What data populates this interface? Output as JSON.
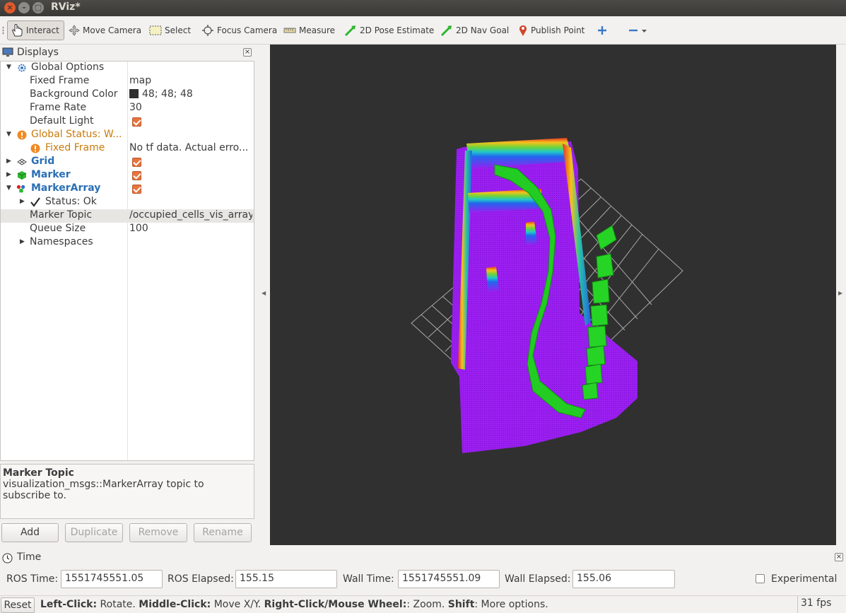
{
  "window": {
    "title": "RViz*"
  },
  "toolbar": {
    "tools": [
      {
        "label": "Interact",
        "icon": "hand-icon",
        "active": true
      },
      {
        "label": "Move Camera",
        "icon": "move-camera-icon"
      },
      {
        "label": "Select",
        "icon": "select-icon"
      },
      {
        "label": "Focus Camera",
        "icon": "focus-camera-icon"
      },
      {
        "label": "Measure",
        "icon": "ruler-icon"
      },
      {
        "label": "2D Pose Estimate",
        "icon": "pose-estimate-icon"
      },
      {
        "label": "2D Nav Goal",
        "icon": "nav-goal-icon"
      },
      {
        "label": "Publish Point",
        "icon": "map-pin-icon"
      }
    ]
  },
  "displays": {
    "title": "Displays",
    "rows": [
      {
        "name": "Global Options",
        "value": ""
      },
      {
        "name": "Fixed Frame",
        "value": "map"
      },
      {
        "name": "Background Color",
        "value": "48; 48; 48"
      },
      {
        "name": "Frame Rate",
        "value": "30"
      },
      {
        "name": "Default Light",
        "value": ""
      },
      {
        "name": "Global Status: W...",
        "value": ""
      },
      {
        "name": "Fixed Frame",
        "value": "No tf data.  Actual erro..."
      },
      {
        "name": "Grid",
        "value": ""
      },
      {
        "name": "Marker",
        "value": ""
      },
      {
        "name": "MarkerArray",
        "value": ""
      },
      {
        "name": "Status: Ok",
        "value": ""
      },
      {
        "name": "Marker Topic",
        "value": "/occupied_cells_vis_array"
      },
      {
        "name": "Queue Size",
        "value": "100"
      },
      {
        "name": "Namespaces",
        "value": ""
      }
    ],
    "description": {
      "title": "Marker Topic",
      "text": "visualization_msgs::MarkerArray topic to subscribe to."
    },
    "buttons": {
      "add": "Add",
      "duplicate": "Duplicate",
      "remove": "Remove",
      "rename": "Rename"
    }
  },
  "time": {
    "title": "Time",
    "ros_time_label": "ROS Time:",
    "ros_time": "1551745551.05",
    "ros_elapsed_label": "ROS Elapsed:",
    "ros_elapsed": "155.15",
    "wall_time_label": "Wall Time:",
    "wall_time": "1551745551.09",
    "wall_elapsed_label": "Wall Elapsed:",
    "wall_elapsed": "155.06",
    "experimental_label": "Experimental"
  },
  "status": {
    "reset_label": "Reset",
    "hint_left_click": "Left-Click:",
    "hint_rotate": " Rotate. ",
    "hint_middle_click": "Middle-Click:",
    "hint_move": " Move X/Y. ",
    "hint_right_click": "Right-Click/Mouse Wheel:",
    "hint_zoom": ": Zoom. ",
    "hint_shift": "Shift",
    "hint_more": ": More options.",
    "fps": "31 fps"
  },
  "colors": {
    "view_background": "#303030",
    "occupancy_floor": "#9b1ff0",
    "path_markers": "#22cc22",
    "accent_orange": "#e8733c",
    "link_blue": "#2a6fb5"
  }
}
